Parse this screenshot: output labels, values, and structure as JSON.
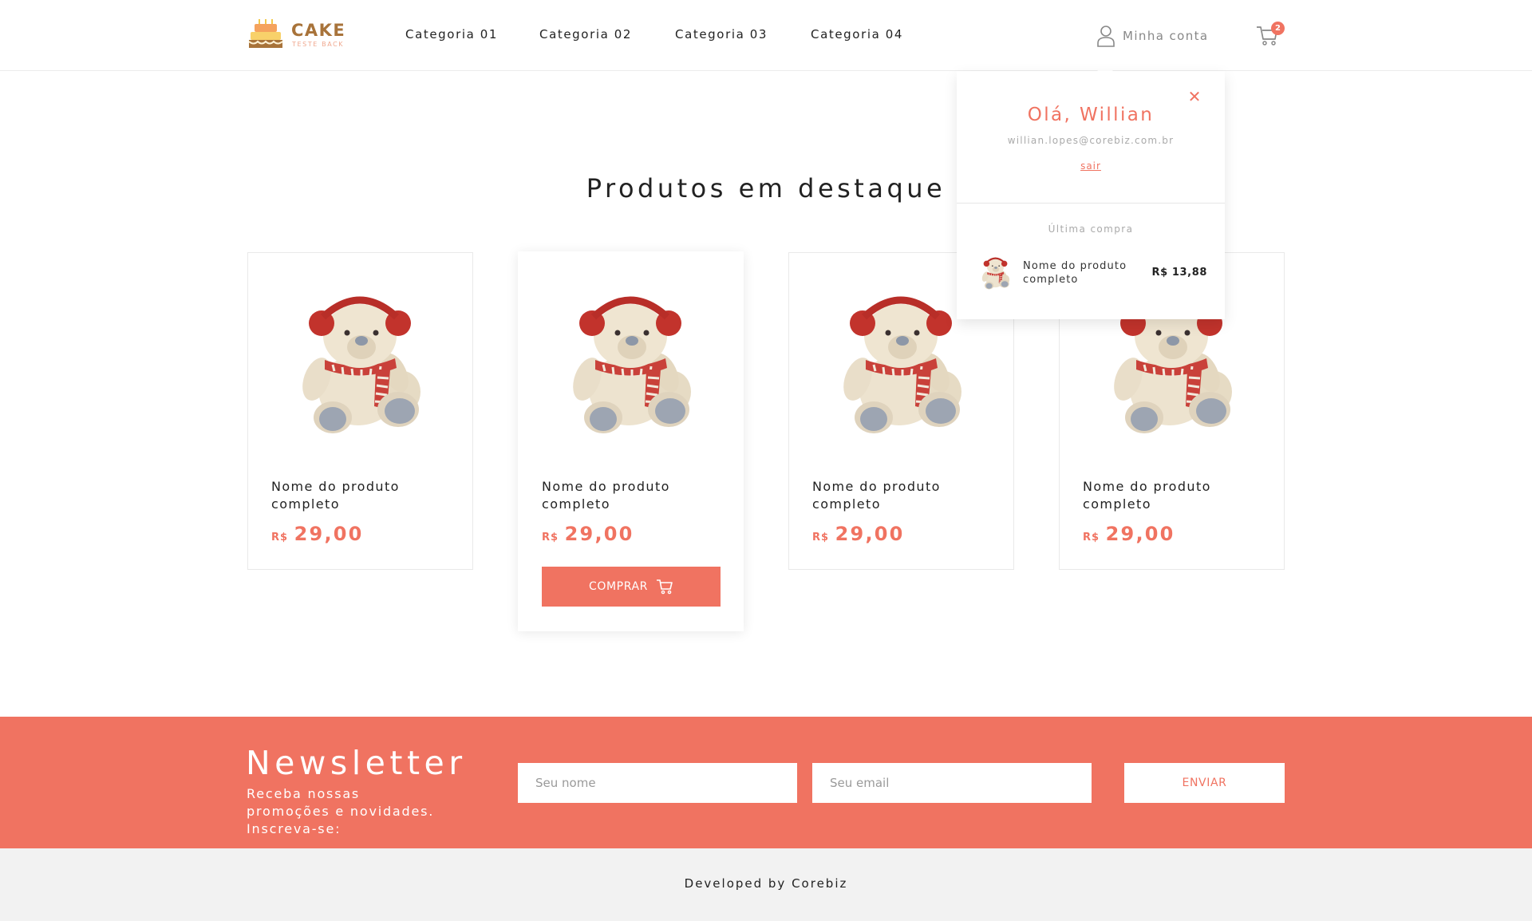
{
  "brand": {
    "name": "CAKE",
    "tagline": "TESTE BACK"
  },
  "nav": {
    "categories": [
      "Categoria 01",
      "Categoria 02",
      "Categoria 03",
      "Categoria 04"
    ],
    "account_label": "Minha conta",
    "cart_count": "2"
  },
  "main": {
    "title": "Produtos em destaque",
    "products": [
      {
        "name": "Nome do produto completo",
        "currency": "R$",
        "price": "29,00"
      },
      {
        "name": "Nome do produto completo",
        "currency": "R$",
        "price": "29,00",
        "buy_label": "COMPRAR"
      },
      {
        "name": "Nome do produto completo",
        "currency": "R$",
        "price": "29,00"
      },
      {
        "name": "Nome do produto completo",
        "currency": "R$",
        "price": "29,00"
      }
    ]
  },
  "account_popup": {
    "greeting": "Olá, Willian",
    "email": "willian.lopes@corebiz.com.br",
    "logout_label": "sair",
    "last_purchase_label": "Última compra",
    "last_purchase": {
      "name": "Nome do produto completo",
      "price": "R$ 13,88"
    }
  },
  "newsletter": {
    "title": "Newsletter",
    "subtitle": "Receba nossas promoções e novidades. Inscreva-se:",
    "name_placeholder": "Seu nome",
    "email_placeholder": "Seu email",
    "submit_label": "ENVIAR"
  },
  "footer": {
    "text": "Developed by Corebiz"
  },
  "colors": {
    "accent": "#f07361",
    "brand_brown": "#a8733a",
    "footer_bg": "#f2f2f2"
  }
}
